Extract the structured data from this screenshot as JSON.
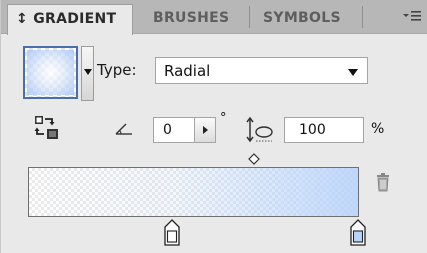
{
  "tabs": [
    {
      "label": "↕ GRADIENT",
      "active": true
    },
    {
      "label": "BRUSHES",
      "active": false
    },
    {
      "label": "SYMBOLS",
      "active": false
    }
  ],
  "menu_icon": "panel-menu-icon",
  "type": {
    "label": "Type:",
    "value": "Radial"
  },
  "angle": {
    "value": "0",
    "unit": "°"
  },
  "aspect": {
    "value": "100",
    "unit": "%"
  },
  "gradient": {
    "start_color": "#ffffff",
    "end_color": "#b9d4fc",
    "midpoint_location": 0.68,
    "stops": [
      0.44,
      1.0
    ]
  },
  "colors": {
    "tab_bar": "#b7b7b7",
    "panel": "#e9e9e9",
    "swatch_border": "#4a6ea9"
  },
  "icons": [
    "reverse-gradient-icon",
    "angle-icon",
    "aspect-ratio-icon",
    "trash-icon",
    "midpoint-diamond-icon",
    "gradient-stop-icon"
  ]
}
